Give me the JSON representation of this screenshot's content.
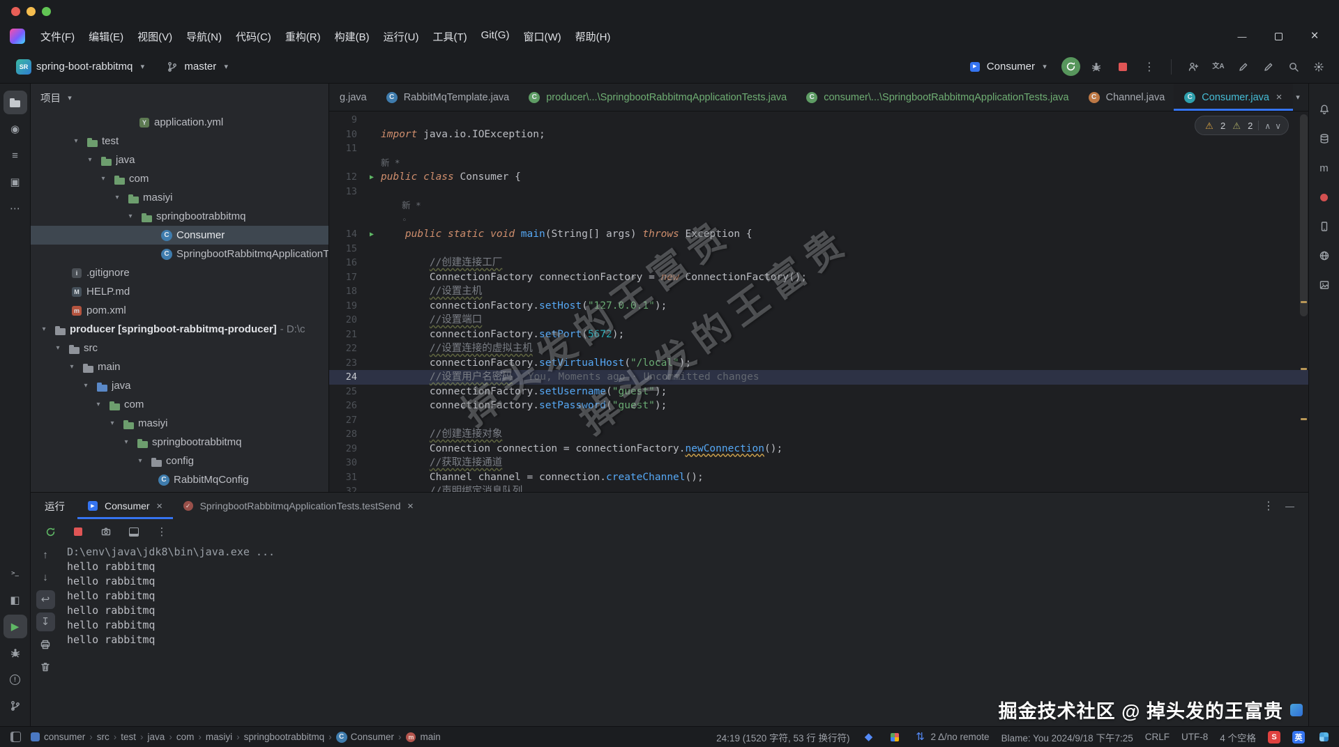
{
  "window": {
    "menus": [
      "文件(F)",
      "编辑(E)",
      "视图(V)",
      "导航(N)",
      "代码(C)",
      "重构(R)",
      "构建(B)",
      "运行(U)",
      "工具(T)",
      "Git(G)",
      "窗口(W)",
      "帮助(H)"
    ]
  },
  "toolbar": {
    "project_avatar": "SR",
    "project_name": "spring-boot-rabbitmq",
    "branch": "master",
    "run_config": "Consumer",
    "right_icons": [
      "collab",
      "translate",
      "pencil",
      "pencil2",
      "search",
      "settings"
    ]
  },
  "editor_tabs": [
    {
      "label": "g.java"
    },
    {
      "label": "RabbitMqTemplate.java",
      "icon": "class-blue"
    },
    {
      "label": "producer\\...\\SpringbootRabbitmqApplicationTests.java",
      "icon": "class-green",
      "state": "green"
    },
    {
      "label": "consumer\\...\\SpringbootRabbitmqApplicationTests.java",
      "icon": "class-green",
      "state": "green"
    },
    {
      "label": "Channel.java",
      "icon": "class-orange"
    },
    {
      "label": "Consumer.java",
      "icon": "class-teal",
      "state": "active",
      "close": true
    }
  ],
  "project_panel": {
    "title": "项目",
    "tree": [
      {
        "label": "application.yml",
        "pad": 144,
        "icon": "file-yml"
      },
      {
        "label": "test",
        "pad": 46,
        "icon": "folder-green",
        "chevron": true
      },
      {
        "label": "java",
        "pad": 66,
        "icon": "folder-green",
        "chevron": true
      },
      {
        "label": "com",
        "pad": 85,
        "icon": "folder-green",
        "chevron": true
      },
      {
        "label": "masiyi",
        "pad": 105,
        "icon": "folder-green",
        "chevron": true
      },
      {
        "label": "springbootrabbitmq",
        "pad": 124,
        "icon": "folder-green",
        "chevron": true
      },
      {
        "label": "Consumer",
        "pad": 176,
        "icon": "class",
        "selected": true
      },
      {
        "label": "SpringbootRabbitmqApplicationTests",
        "pad": 176,
        "icon": "class"
      },
      {
        "label": ".gitignore",
        "pad": 47,
        "icon": "file-ignore"
      },
      {
        "label": "HELP.md",
        "pad": 47,
        "icon": "file-md"
      },
      {
        "label": "pom.xml",
        "pad": 47,
        "icon": "file-pom"
      },
      {
        "label": "producer [springboot-rabbitmq-producer]",
        "suffix": " - D:\\c",
        "pad": 0,
        "icon": "folder",
        "chevron": true,
        "bold": true
      },
      {
        "label": "src",
        "pad": 20,
        "icon": "folder",
        "chevron": true
      },
      {
        "label": "main",
        "pad": 40,
        "icon": "folder",
        "chevron": true
      },
      {
        "label": "java",
        "pad": 60,
        "icon": "folder-blue",
        "chevron": true
      },
      {
        "label": "com",
        "pad": 78,
        "icon": "folder-green",
        "chevron": true
      },
      {
        "label": "masiyi",
        "pad": 98,
        "icon": "folder-green",
        "chevron": true
      },
      {
        "label": "springbootrabbitmq",
        "pad": 118,
        "icon": "folder-green",
        "chevron": true
      },
      {
        "label": "config",
        "pad": 138,
        "icon": "folder",
        "chevron": true
      },
      {
        "label": "RabbitMqConfig",
        "pad": 172,
        "icon": "class"
      }
    ]
  },
  "editor": {
    "warning_counts": [
      "2",
      "2"
    ],
    "watermark_line1": "掉头发的王富贵",
    "watermark_line2": "掉头发的王富贵",
    "rows": [
      {
        "ln": "9",
        "segs": []
      },
      {
        "ln": "10",
        "segs": [
          [
            "k",
            "import"
          ],
          [
            "d",
            " java.io.IOException;"
          ]
        ]
      },
      {
        "ln": "11",
        "segs": []
      },
      {
        "ln": "",
        "segs": [
          [
            "h",
            "新 *"
          ]
        ]
      },
      {
        "ln": "12",
        "run": true,
        "segs": [
          [
            "k",
            "public class"
          ],
          [
            "d",
            " Consumer {"
          ]
        ]
      },
      {
        "ln": "13",
        "segs": []
      },
      {
        "ln": "",
        "segs": [
          [
            "h",
            "    新 *"
          ]
        ]
      },
      {
        "ln": "",
        "segs": [
          [
            "h",
            "    ◦"
          ]
        ]
      },
      {
        "ln": "14",
        "run": true,
        "segs": [
          [
            "d",
            "    "
          ],
          [
            "k",
            "public static void"
          ],
          [
            "m",
            " main"
          ],
          [
            "d",
            "(String[] args) "
          ],
          [
            "k",
            "throws"
          ],
          [
            "d",
            " Exception {"
          ]
        ]
      },
      {
        "ln": "15",
        "segs": []
      },
      {
        "ln": "16",
        "segs": [
          [
            "d",
            "        "
          ],
          [
            "c",
            "//创建连接工厂"
          ]
        ]
      },
      {
        "ln": "17",
        "segs": [
          [
            "d",
            "        ConnectionFactory connectionFactory = "
          ],
          [
            "k",
            "new"
          ],
          [
            "d",
            " ConnectionFactory();"
          ]
        ]
      },
      {
        "ln": "18",
        "segs": [
          [
            "d",
            "        "
          ],
          [
            "c",
            "//设置主机"
          ]
        ]
      },
      {
        "ln": "19",
        "segs": [
          [
            "d",
            "        connectionFactory."
          ],
          [
            "m",
            "setHost"
          ],
          [
            "d",
            "("
          ],
          [
            "s",
            "\"127.0.0.1\""
          ],
          [
            "d",
            ");"
          ]
        ]
      },
      {
        "ln": "20",
        "segs": [
          [
            "d",
            "        "
          ],
          [
            "c",
            "//设置端口"
          ]
        ]
      },
      {
        "ln": "21",
        "segs": [
          [
            "d",
            "        connectionFactory."
          ],
          [
            "m",
            "setPort"
          ],
          [
            "d",
            "("
          ],
          [
            "n",
            "5672"
          ],
          [
            "d",
            ");"
          ]
        ]
      },
      {
        "ln": "22",
        "segs": [
          [
            "d",
            "        "
          ],
          [
            "c",
            "//设置连接的虚拟主机"
          ]
        ]
      },
      {
        "ln": "23",
        "segs": [
          [
            "d",
            "        connectionFactory."
          ],
          [
            "m",
            "setVirtualHost"
          ],
          [
            "d",
            "("
          ],
          [
            "s",
            "\"/local\""
          ],
          [
            "d",
            ");"
          ]
        ]
      },
      {
        "ln": "24",
        "current": true,
        "segs": [
          [
            "d",
            "        "
          ],
          [
            "c",
            "//设置用户名密码"
          ],
          [
            "b",
            "You, Moments ago · Uncommitted changes"
          ]
        ]
      },
      {
        "ln": "25",
        "segs": [
          [
            "d",
            "        connectionFactory."
          ],
          [
            "m",
            "setUsername"
          ],
          [
            "d",
            "("
          ],
          [
            "s",
            "\"guest\""
          ],
          [
            "d",
            ");"
          ]
        ]
      },
      {
        "ln": "26",
        "segs": [
          [
            "d",
            "        connectionFactory."
          ],
          [
            "m",
            "setPassword"
          ],
          [
            "d",
            "("
          ],
          [
            "s",
            "\"guest\""
          ],
          [
            "d",
            ");"
          ]
        ]
      },
      {
        "ln": "27",
        "segs": []
      },
      {
        "ln": "28",
        "segs": [
          [
            "d",
            "        "
          ],
          [
            "c",
            "//创建连接对象"
          ]
        ]
      },
      {
        "ln": "29",
        "segs": [
          [
            "d",
            "        Connection connection = connectionFactory."
          ],
          [
            "u",
            "newConnection"
          ],
          [
            "d",
            "();"
          ]
        ]
      },
      {
        "ln": "30",
        "segs": [
          [
            "d",
            "        "
          ],
          [
            "c",
            "//获取连接通道"
          ]
        ]
      },
      {
        "ln": "31",
        "segs": [
          [
            "d",
            "        Channel channel = connection."
          ],
          [
            "m",
            "createChannel"
          ],
          [
            "d",
            "();"
          ]
        ]
      },
      {
        "ln": "32",
        "segs": [
          [
            "d",
            "        "
          ],
          [
            "c",
            "//声明绑定消息队列"
          ]
        ]
      }
    ]
  },
  "run_panel": {
    "title": "运行",
    "tabs": [
      {
        "label": "Consumer",
        "icon": "run-app",
        "active": true,
        "close": true
      },
      {
        "label": "SpringbootRabbitmqApplicationTests.testSend",
        "icon": "junit",
        "close": true
      }
    ],
    "toolbar": [
      "rerun",
      "stopsq",
      "camera",
      "layout",
      "kebab"
    ],
    "console_tools": [
      {
        "name": "up"
      },
      {
        "name": "down"
      },
      {
        "name": "softwrap",
        "active": true
      },
      {
        "name": "scrollend",
        "active": true
      },
      {
        "name": "print"
      },
      {
        "name": "clear"
      }
    ],
    "console": [
      {
        "text": "D:\\env\\java\\jdk8\\bin\\java.exe ...",
        "style": "dim"
      },
      {
        "text": "hello rabbitmq"
      },
      {
        "text": "hello rabbitmq"
      },
      {
        "text": "hello rabbitmq"
      },
      {
        "text": "hello rabbitmq"
      },
      {
        "text": "hello rabbitmq"
      },
      {
        "text": "hello rabbitmq"
      }
    ]
  },
  "docks": {
    "left_top": [
      {
        "name": "project",
        "active": true
      },
      {
        "name": "commit"
      },
      {
        "name": "structure"
      },
      {
        "name": "dependencies"
      },
      {
        "name": "more"
      }
    ],
    "left_bottom": [
      {
        "name": "terminal"
      },
      {
        "name": "services"
      },
      {
        "name": "run",
        "active": true
      },
      {
        "name": "debug"
      },
      {
        "name": "problems"
      },
      {
        "name": "vcs"
      }
    ],
    "right": [
      {
        "name": "notifications"
      },
      {
        "name": "database"
      },
      {
        "name": "maven"
      },
      {
        "name": "record"
      },
      {
        "name": "device"
      },
      {
        "name": "translate-globe"
      },
      {
        "name": "image"
      }
    ]
  },
  "status_bar": {
    "breadcrumbs": [
      {
        "label": "consumer",
        "icon": "module"
      },
      {
        "label": "src"
      },
      {
        "label": "test"
      },
      {
        "label": "java"
      },
      {
        "label": "com"
      },
      {
        "label": "masiyi"
      },
      {
        "label": "springbootrabbitmq"
      },
      {
        "label": "Consumer",
        "icon": "class-blue"
      },
      {
        "label": "main",
        "icon": "method"
      }
    ],
    "items": [
      {
        "type": "text",
        "text": "24:19 (1520 字符, 53 行 换行符)"
      },
      {
        "type": "icon",
        "name": "plugin"
      },
      {
        "type": "icon",
        "name": "colors"
      },
      {
        "type": "git",
        "text": "2 Δ/no remote"
      },
      {
        "type": "text",
        "text": "Blame: You 2024/9/18 下午7:25"
      },
      {
        "type": "text",
        "text": "CRLF"
      },
      {
        "type": "text",
        "text": "UTF-8"
      },
      {
        "type": "text",
        "text": "4 个空格"
      },
      {
        "type": "badge",
        "text": "S",
        "style": "sogou"
      },
      {
        "type": "badge",
        "text": "英",
        "style": "lang"
      },
      {
        "type": "icon",
        "name": "ime-grid"
      }
    ]
  },
  "watermark": {
    "footer": "掘金技术社区 @ 掉头发的王富贵"
  }
}
